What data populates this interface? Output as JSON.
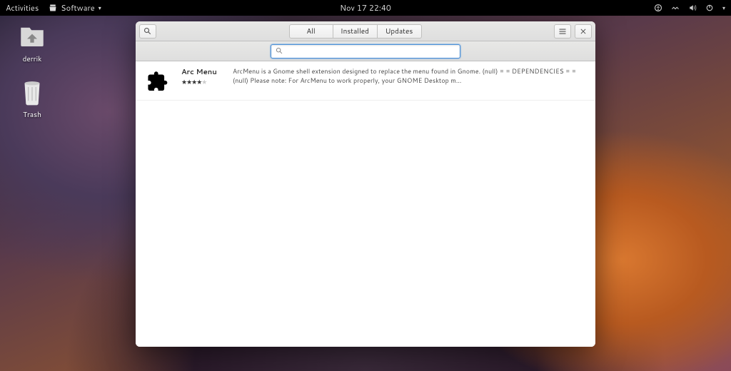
{
  "topbar": {
    "activities": "Activities",
    "app_name": "Software",
    "clock": "Nov 17  22:40"
  },
  "desktop": {
    "icons": [
      {
        "name": "home-folder",
        "label": "derrik"
      },
      {
        "name": "trash",
        "label": "Trash"
      }
    ]
  },
  "window": {
    "tabs": {
      "all": "All",
      "installed": "Installed",
      "updates": "Updates"
    },
    "search": {
      "value": "",
      "placeholder": ""
    },
    "results": [
      {
        "name": "Arc Menu",
        "rating_full": 4,
        "rating_empty": 1,
        "description": "ArcMenu is a Gnome shell extension designed to replace the menu found in Gnome.   (null)  = =  DEPENDENCIES = =   (null)  Please note: For ArcMenu to work properly, your GNOME Desktop m…"
      }
    ]
  }
}
